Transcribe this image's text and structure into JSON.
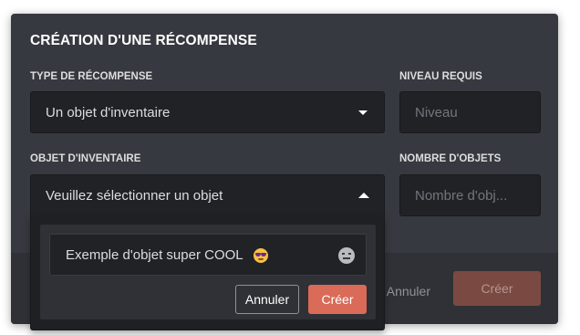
{
  "modal": {
    "title": "CRÉATION D'UNE RÉCOMPENSE",
    "reward_type": {
      "label": "TYPE DE RÉCOMPENSE",
      "value": "Un objet d'inventaire"
    },
    "required_level": {
      "label": "NIVEAU REQUIS",
      "placeholder": "Niveau"
    },
    "inventory_object": {
      "label": "OBJET D'INVENTAIRE",
      "value": "Veuillez sélectionner un objet"
    },
    "object_count": {
      "label": "NOMBRE D'OBJETS",
      "placeholder": "Nombre d'obj..."
    },
    "footer": {
      "cancel_label": "Annuler",
      "create_label": "Créer"
    }
  },
  "dropdown": {
    "option_text": "Exemple d'objet super COOL",
    "option_emoji": "smiling-face-with-sunglasses",
    "cancel_label": "Annuler",
    "create_label": "Créer"
  },
  "colors": {
    "modal_bg": "#36393f",
    "field_bg": "#202225",
    "footer_bg": "#2f3136",
    "accent_create": "#d96b58",
    "accent_create_disabled": "#7a4a42"
  }
}
